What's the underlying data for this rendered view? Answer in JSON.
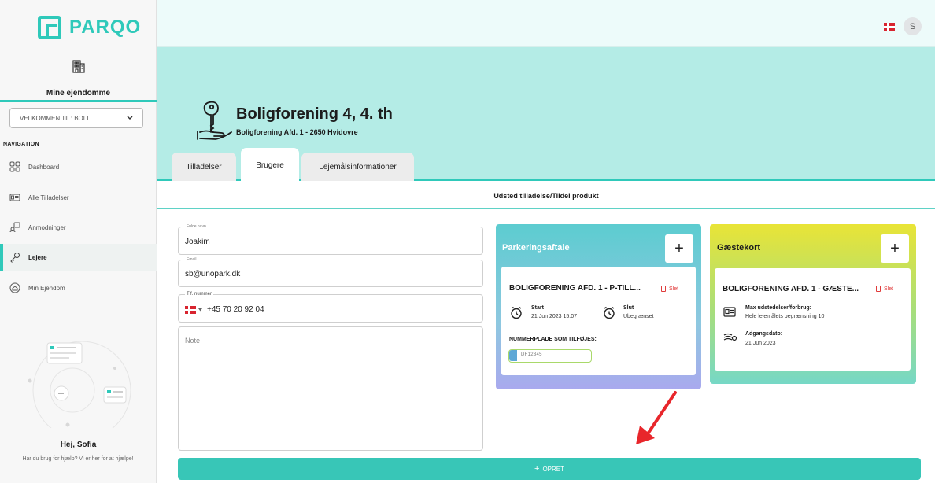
{
  "brand": {
    "name": "PARQO",
    "accent": "#2fc9ba"
  },
  "sidebar": {
    "property_label": "Mine ejendomme",
    "welcome_select": "VELKOMMEN TIL: BOLI...",
    "nav_title": "NAVIGATION",
    "items": [
      {
        "label": "Dashboard",
        "icon": "dashboard-icon",
        "active": false
      },
      {
        "label": "Alle Tilladelser",
        "icon": "id-card-icon",
        "active": false
      },
      {
        "label": "Anmodninger",
        "icon": "requests-icon",
        "active": false
      },
      {
        "label": "Lejere",
        "icon": "key-icon",
        "active": true
      },
      {
        "label": "Min Ejendom",
        "icon": "home-icon",
        "active": false
      }
    ],
    "help": {
      "greeting": "Hej, Sofia",
      "text": "Har du brug for hjælp? Vi er her for at hjælpe!"
    }
  },
  "topbar": {
    "avatar_initial": "S",
    "language_flag": "danish-flag-icon"
  },
  "header": {
    "title": "Boligforening 4, 4. th",
    "subtitle": "Boligforening Afd. 1 - 2650 Hvidovre",
    "tabs": [
      {
        "label": "Tilladelser",
        "active": false
      },
      {
        "label": "Brugere",
        "active": true
      },
      {
        "label": "Lejemålsinformationer",
        "active": false
      }
    ]
  },
  "subheader": "Udsted tilladelse/Tildel produkt",
  "form": {
    "name": {
      "label": "Fulde navn",
      "value": "Joakim"
    },
    "email": {
      "label": "Email",
      "value": "sb@unopark.dk"
    },
    "phone": {
      "label": "Tlf. nummer",
      "value": "+45 70 20 92 04"
    },
    "note": {
      "placeholder": "Note"
    }
  },
  "parking": {
    "title": "Parkeringsaftale",
    "item_title": "BOLIGFORENING AFD. 1 - P-TILL...",
    "delete": "Slet",
    "start_label": "Start",
    "start_value": "21 Jun 2023 15:07",
    "end_label": "Slut",
    "end_value": "Ubegrænset",
    "plate_heading": "NUMMERPLADE SOM TILFØJES:",
    "plate_value": "DF12345"
  },
  "guest": {
    "title": "Gæstekort",
    "item_title": "BOLIGFORENING AFD. 1 - GÆSTE...",
    "delete": "Slet",
    "max_label": "Max udstedelser/forbrug:",
    "max_value": "Hele lejemålets begrænsning 10",
    "access_label": "Adgangsdato:",
    "access_value": "21 Jun 2023"
  },
  "create_button": "OPRET"
}
